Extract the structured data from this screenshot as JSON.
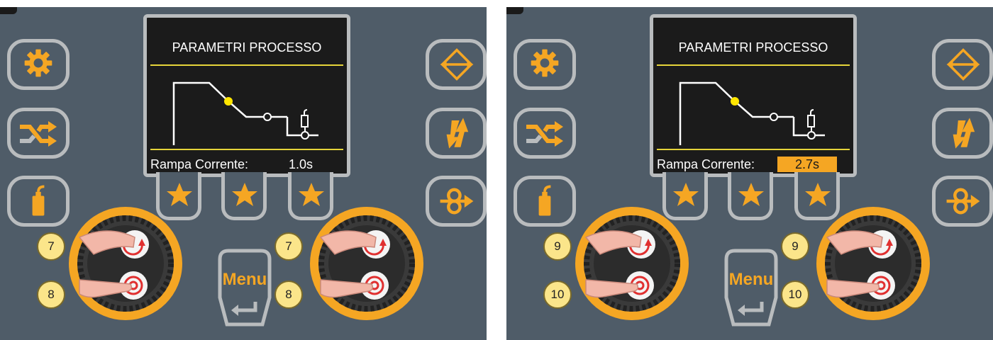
{
  "panels": [
    {
      "screen_title": "PARAMETRI PROCESSO",
      "param_label": "Rampa Corrente:",
      "param_value": "1.0s",
      "steps": {
        "rotate": "7",
        "press": "8"
      }
    },
    {
      "screen_title": "PARAMETRI PROCESSO",
      "param_label": "Rampa Corrente:",
      "param_value": "2.7s",
      "steps": {
        "rotate": "9",
        "press": "10"
      }
    }
  ],
  "menu_label": "Menu",
  "icons": {
    "left_column": [
      "gear-icon",
      "shuffle-icon",
      "gas-bottle-icon"
    ],
    "right_column": [
      "swap-diamond-icon",
      "double-arrow-icon",
      "wire-feed-icon"
    ],
    "favorites": [
      "star-icon",
      "star-icon",
      "star-icon"
    ]
  },
  "colors": {
    "accent": "#f5a623",
    "panel": "#4f5c68",
    "screen": "#1b1b1b",
    "graph_highlight": "#ffe600",
    "step_badge": "#fbe58a"
  }
}
